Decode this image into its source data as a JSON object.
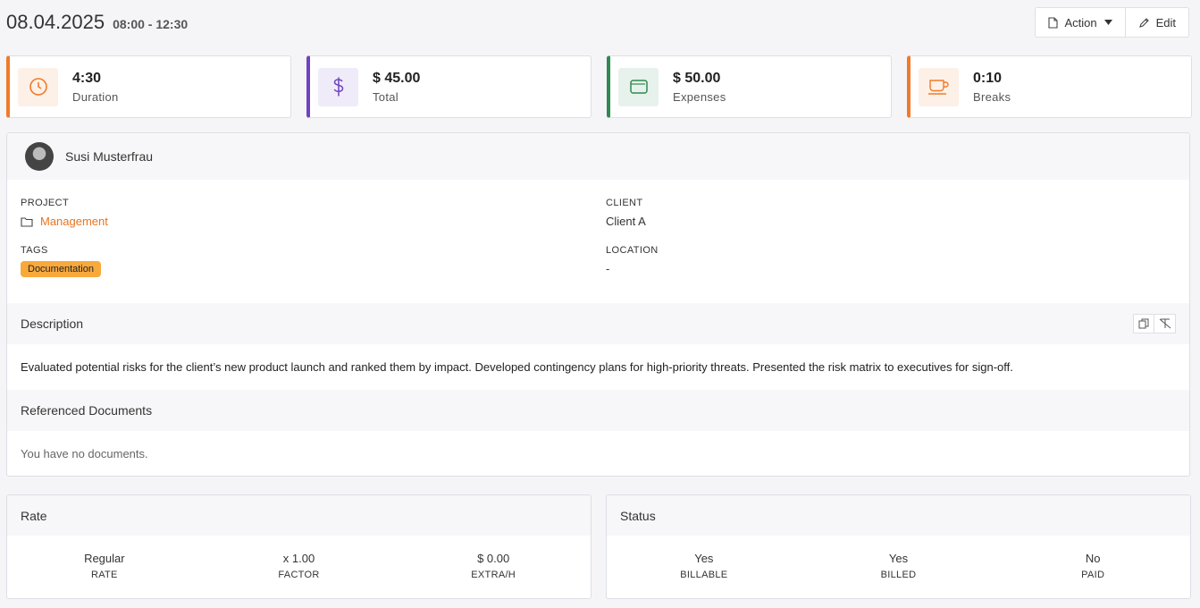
{
  "header": {
    "date": "08.04.2025",
    "time_range": "08:00 - 12:30"
  },
  "toolbar": {
    "action_label": "Action",
    "edit_label": "Edit"
  },
  "stats": [
    {
      "value": "4:30",
      "label": "Duration",
      "color": "#f07b2b",
      "icon": "clock-icon"
    },
    {
      "value": "$ 45.00",
      "label": "Total",
      "color": "#6f42c1",
      "icon": "dollar-icon"
    },
    {
      "value": "$ 50.00",
      "label": "Expenses",
      "color": "#2f8a4f",
      "icon": "wallet-icon"
    },
    {
      "value": "0:10",
      "label": "Breaks",
      "color": "#f07b2b",
      "icon": "coffee-cup-icon"
    }
  ],
  "user": {
    "name": "Susi Musterfrau"
  },
  "fields": {
    "project_label": "PROJECT",
    "project_value": "Management",
    "client_label": "CLIENT",
    "client_value": "Client A",
    "tags_label": "TAGS",
    "tag": "Documentation",
    "location_label": "LOCATION",
    "location_value": "-"
  },
  "description": {
    "title": "Description",
    "text": "Evaluated potential risks for the client’s new product launch and ranked them by impact. Developed contingency plans for high-priority threats. Presented the risk matrix to executives for sign-off."
  },
  "documents": {
    "title": "Referenced Documents",
    "empty": "You have no documents."
  },
  "rate": {
    "title": "Rate",
    "items": [
      {
        "value": "Regular",
        "label": "RATE"
      },
      {
        "value": "x 1.00",
        "label": "FACTOR"
      },
      {
        "value": "$ 0.00",
        "label": "EXTRA/H"
      }
    ]
  },
  "status": {
    "title": "Status",
    "items": [
      {
        "value": "Yes",
        "label": "BILLABLE"
      },
      {
        "value": "Yes",
        "label": "BILLED"
      },
      {
        "value": "No",
        "label": "PAID"
      }
    ]
  },
  "colors": {
    "accent": "#e8741e",
    "tag_bg": "#f8a93c"
  }
}
